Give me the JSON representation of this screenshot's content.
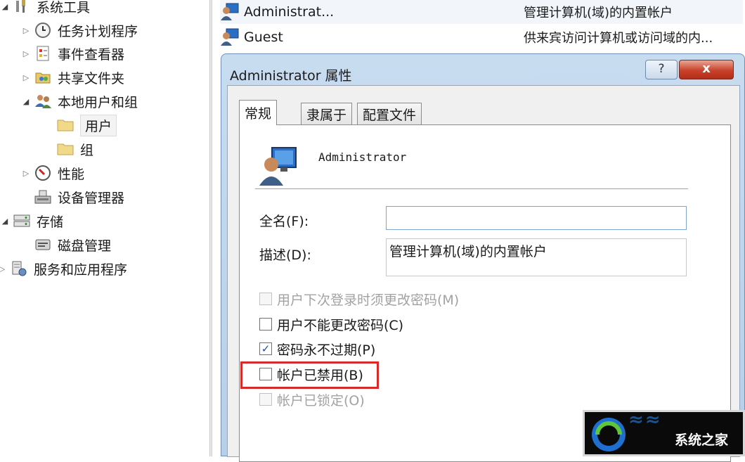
{
  "tree": {
    "items": [
      {
        "label": "系统工具",
        "icon": "tools-icon",
        "arrow": "open"
      },
      {
        "label": "任务计划程序",
        "icon": "clock-icon",
        "arrow": "closed"
      },
      {
        "label": "事件查看器",
        "icon": "event-viewer-icon",
        "arrow": "closed"
      },
      {
        "label": "共享文件夹",
        "icon": "shared-folder-icon",
        "arrow": "closed"
      },
      {
        "label": "本地用户和组",
        "icon": "users-group-icon",
        "arrow": "open"
      },
      {
        "label": "用户",
        "icon": "folder-icon",
        "arrow": "none"
      },
      {
        "label": "组",
        "icon": "folder-icon",
        "arrow": "none"
      },
      {
        "label": "性能",
        "icon": "performance-icon",
        "arrow": "closed"
      },
      {
        "label": "设备管理器",
        "icon": "device-manager-icon",
        "arrow": "none"
      },
      {
        "label": "存储",
        "icon": "storage-icon",
        "arrow": "open"
      },
      {
        "label": "磁盘管理",
        "icon": "disk-management-icon",
        "arrow": "none"
      },
      {
        "label": "服务和应用程序",
        "icon": "services-icon",
        "arrow": "closed"
      }
    ],
    "selected": "用户"
  },
  "list": {
    "rows": [
      {
        "name": "Administrat...",
        "description": "管理计算机(域)的内置帐户"
      },
      {
        "name": "Guest",
        "description": "供来宾访问计算机或访问域的内..."
      }
    ]
  },
  "dialog": {
    "title": "Administrator 属性",
    "help_label": "?",
    "close_label": "x",
    "tabs": [
      "常规",
      "隶属于",
      "配置文件"
    ],
    "active_tab": "常规",
    "user_name": "Administrator",
    "fullname_label": "全名(F):",
    "fullname_value": "",
    "description_label": "描述(D):",
    "description_value": "管理计算机(域)的内置帐户",
    "checkboxes": [
      {
        "label": "用户下次登录时须更改密码(M)",
        "checked": false,
        "enabled": false
      },
      {
        "label": "用户不能更改密码(C)",
        "checked": false,
        "enabled": true
      },
      {
        "label": "密码永不过期(P)",
        "checked": true,
        "enabled": true
      },
      {
        "label": "帐户已禁用(B)",
        "checked": false,
        "enabled": true
      },
      {
        "label": "帐户已锁定(O)",
        "checked": false,
        "enabled": false
      }
    ]
  },
  "watermark": {
    "brand": "系统之家"
  },
  "colors": {
    "highlight": "#d62b2b",
    "titlebar": "#c8dcf0",
    "close": "#c9412a"
  }
}
